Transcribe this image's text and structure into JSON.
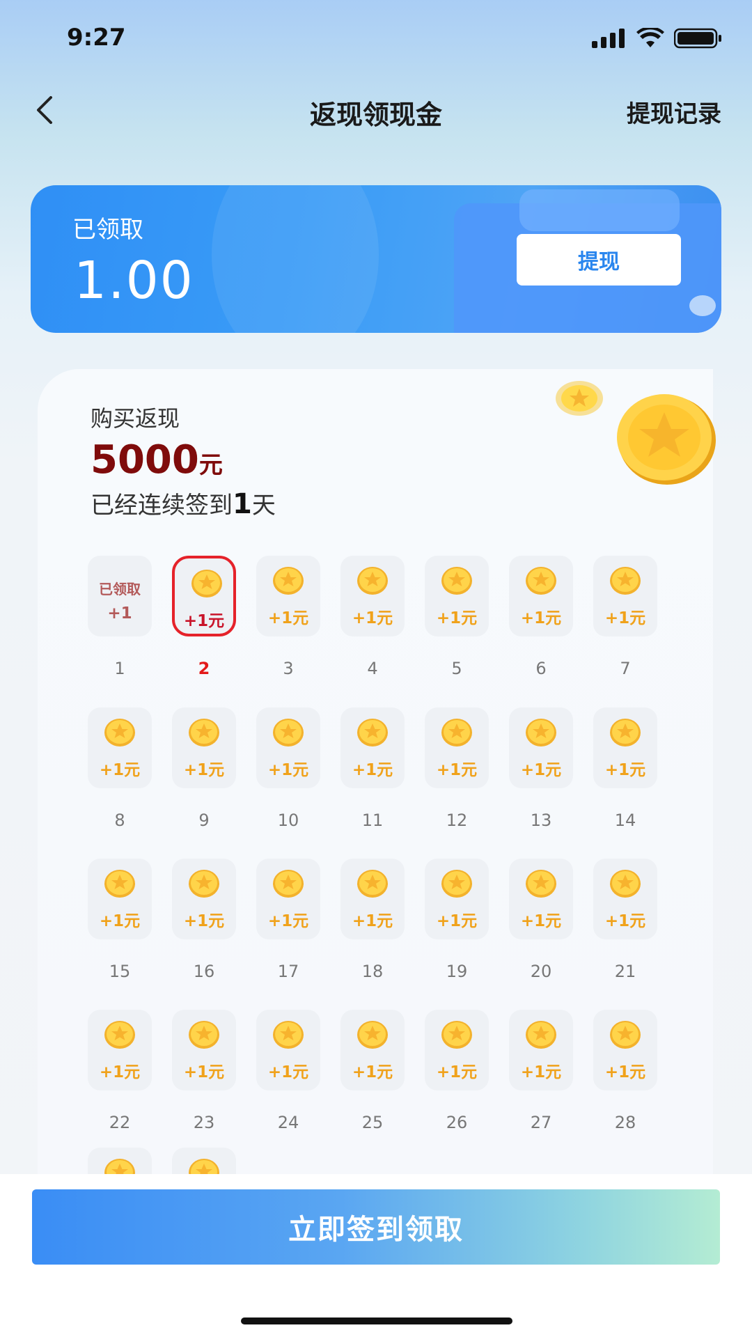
{
  "status_bar": {
    "time": "9:27"
  },
  "nav": {
    "title": "返现领现金",
    "right_link": "提现记录"
  },
  "balance_card": {
    "label": "已领取",
    "amount": "1.00",
    "withdraw_label": "提现"
  },
  "promo": {
    "label": "购买返现",
    "amount_number": "5000",
    "amount_unit": "元",
    "streak_prefix": "已经连续签到",
    "streak_days": "1",
    "streak_suffix": "天"
  },
  "days": [
    {
      "day": "1",
      "reward": "+1",
      "claimed_label": "已领取",
      "state": "claimed"
    },
    {
      "day": "2",
      "reward": "+1元",
      "state": "today"
    },
    {
      "day": "3",
      "reward": "+1元"
    },
    {
      "day": "4",
      "reward": "+1元"
    },
    {
      "day": "5",
      "reward": "+1元"
    },
    {
      "day": "6",
      "reward": "+1元"
    },
    {
      "day": "7",
      "reward": "+1元"
    },
    {
      "day": "8",
      "reward": "+1元"
    },
    {
      "day": "9",
      "reward": "+1元"
    },
    {
      "day": "10",
      "reward": "+1元"
    },
    {
      "day": "11",
      "reward": "+1元"
    },
    {
      "day": "12",
      "reward": "+1元"
    },
    {
      "day": "13",
      "reward": "+1元"
    },
    {
      "day": "14",
      "reward": "+1元"
    },
    {
      "day": "15",
      "reward": "+1元"
    },
    {
      "day": "16",
      "reward": "+1元"
    },
    {
      "day": "17",
      "reward": "+1元"
    },
    {
      "day": "18",
      "reward": "+1元"
    },
    {
      "day": "19",
      "reward": "+1元"
    },
    {
      "day": "20",
      "reward": "+1元"
    },
    {
      "day": "21",
      "reward": "+1元"
    },
    {
      "day": "22",
      "reward": "+1元"
    },
    {
      "day": "23",
      "reward": "+1元"
    },
    {
      "day": "24",
      "reward": "+1元"
    },
    {
      "day": "25",
      "reward": "+1元"
    },
    {
      "day": "26",
      "reward": "+1元"
    },
    {
      "day": "27",
      "reward": "+1元"
    },
    {
      "day": "28",
      "reward": "+1元"
    }
  ],
  "cta": {
    "label": "立即签到领取"
  },
  "colors": {
    "accent": "#2f8ff5",
    "reward": "#f0a21b",
    "today": "#e5222a",
    "promo_amount": "#7f0b0b"
  }
}
